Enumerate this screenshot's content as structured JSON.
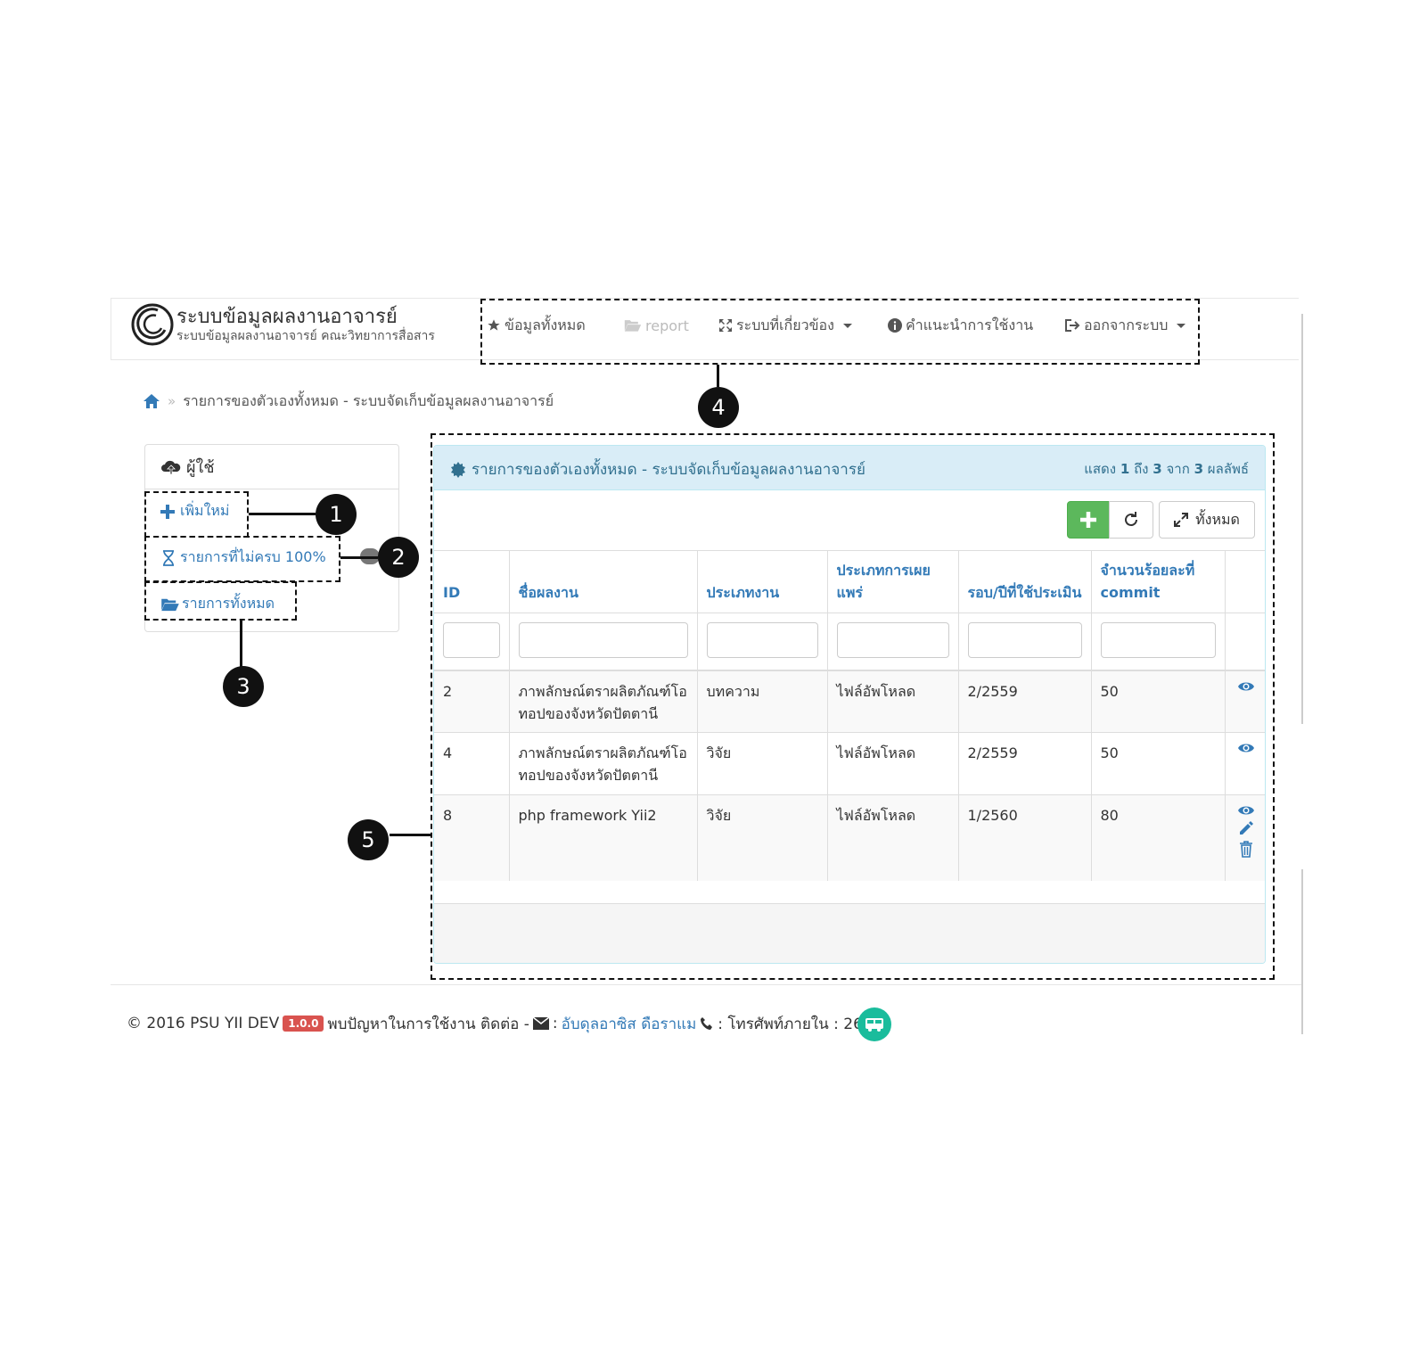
{
  "navbar": {
    "brand_title": "ระบบข้อมูลผลงานอาจารย์",
    "brand_subtitle": "ระบบข้อมูลผลงานอาจารย์ คณะวิทยาการสื่อสาร",
    "items": [
      {
        "label": "ข้อมูลทั้งหมด",
        "icon": "star-icon"
      },
      {
        "label": "report",
        "icon": "folder-open-icon",
        "disabled": true
      },
      {
        "label": "ระบบที่เกี่ยวข้อง",
        "icon": "fullscreen-icon",
        "dropdown": true
      },
      {
        "label": "คำแนะนำการใช้งาน",
        "icon": "info-circle-icon"
      },
      {
        "label": "ออกจากระบบ",
        "icon": "logout-icon",
        "dropdown": true
      }
    ]
  },
  "breadcrumb": {
    "separator": "»",
    "current": "รายการของตัวเองทั้งหมด - ระบบจัดเก็บข้อมูลผลงานอาจารย์"
  },
  "sidebar": {
    "title": "ผู้ใช้",
    "links": [
      {
        "label": "เพิ่มใหม่",
        "icon": "plus-icon"
      },
      {
        "label": "รายการที่ไม่ครบ 100%",
        "icon": "hourglass-icon"
      },
      {
        "label": "รายการทั้งหมด",
        "icon": "folder-open-icon"
      }
    ]
  },
  "main": {
    "title": "รายการของตัวเองทั้งหมด - ระบบจัดเก็บข้อมูลผลงานอาจารย์",
    "summary": {
      "prefix": "แสดง",
      "from": "1",
      "to_word": "ถึง",
      "to": "3",
      "of_word": "จาก",
      "total": "3",
      "suffix": "ผลลัพธ์"
    },
    "toolbar": {
      "all_label": "ทั้งหมด"
    },
    "columns": [
      "ID",
      "ชื่อผลงาน",
      "ประเภทงาน",
      "ประเภทการเผยแพร่",
      "รอบ/ปีที่ใช้ประเมิน",
      "จำนวนร้อยละที่ commit"
    ],
    "rows": [
      {
        "id": "2",
        "name": "ภาพลักษณ์ตราผลิตภัณฑ์โอทอปของจังหวัดปัตตานี",
        "type": "บทความ",
        "publish": "ไฟล์อัพโหลด",
        "round": "2/2559",
        "commit": "50",
        "actions": [
          "eye-icon"
        ]
      },
      {
        "id": "4",
        "name": "ภาพลักษณ์ตราผลิตภัณฑ์โอทอปของจังหวัดปัตตานี",
        "type": "วิจัย",
        "publish": "ไฟล์อัพโหลด",
        "round": "2/2559",
        "commit": "50",
        "actions": [
          "eye-icon"
        ]
      },
      {
        "id": "8",
        "name": "php framework Yii2",
        "type": "วิจัย",
        "publish": "ไฟล์อัพโหลด",
        "round": "1/2560",
        "commit": "80",
        "actions": [
          "eye-icon",
          "pencil-icon",
          "trash-icon"
        ]
      }
    ]
  },
  "footer": {
    "copyright": "© 2016 PSU YII DEV",
    "version": "1.0.0",
    "problem_text": "พบปัญหาในการใช้งาน ติดต่อ -",
    "contact_sep": ":",
    "contact_name": "อับดุลอาซิส ดือราแม",
    "phone_text": ": โทรศัพท์ภายใน : 2618"
  },
  "callouts": [
    "1",
    "2",
    "3",
    "4",
    "5"
  ],
  "colors": {
    "link": "#337ab7",
    "panel_head": "#d9edf7",
    "success": "#5cb85c",
    "danger": "#d9534f",
    "fab": "#1abc9c"
  }
}
